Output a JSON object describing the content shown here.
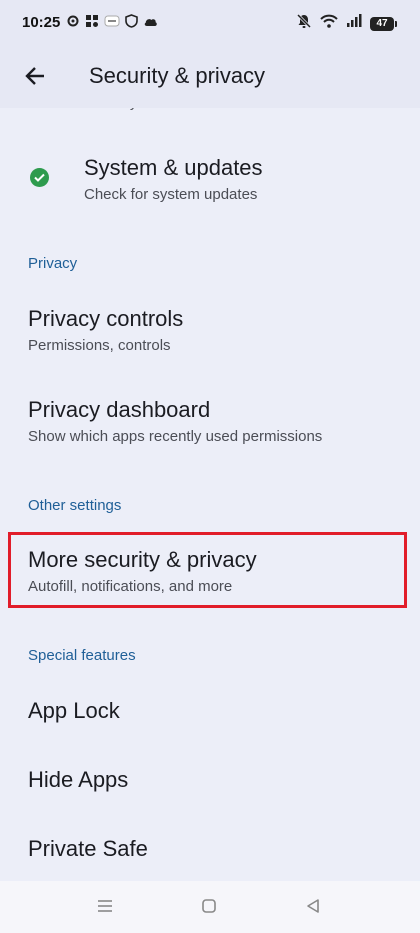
{
  "status_bar": {
    "time": "10:25",
    "battery_level": "47",
    "icons_left": [
      "gear-icon",
      "grid-apps-icon",
      "notification-badge-icon",
      "shield-icon",
      "cloud-icon"
    ],
    "icons_right": [
      "bell-off-icon",
      "wifi-icon",
      "signal-icon",
      "battery-icon"
    ]
  },
  "app_bar": {
    "title": "Security & privacy",
    "back_icon": "back-arrow-icon"
  },
  "list": {
    "peek_item": "Find My Device",
    "system_updates": {
      "title": "System & updates",
      "subtitle": "Check for system updates",
      "status_color": "#2e9b4e"
    },
    "privacy_header": "Privacy",
    "privacy_controls": {
      "title": "Privacy controls",
      "subtitle": "Permissions, controls"
    },
    "privacy_dashboard": {
      "title": "Privacy dashboard",
      "subtitle": "Show which apps recently used permissions"
    },
    "other_settings_header": "Other settings",
    "more_security": {
      "title": "More security & privacy",
      "subtitle": "Autofill, notifications, and more"
    },
    "special_features_header": "Special features",
    "app_lock": {
      "title": "App Lock"
    },
    "hide_apps": {
      "title": "Hide Apps"
    },
    "private_safe": {
      "title": "Private Safe"
    }
  },
  "nav_bar": {
    "buttons": [
      "menu-icon",
      "home-icon",
      "back-triangle-icon"
    ]
  },
  "colors": {
    "background": "#eceef8",
    "section_header": "#1f5f97",
    "highlight": "#e11c2a"
  }
}
